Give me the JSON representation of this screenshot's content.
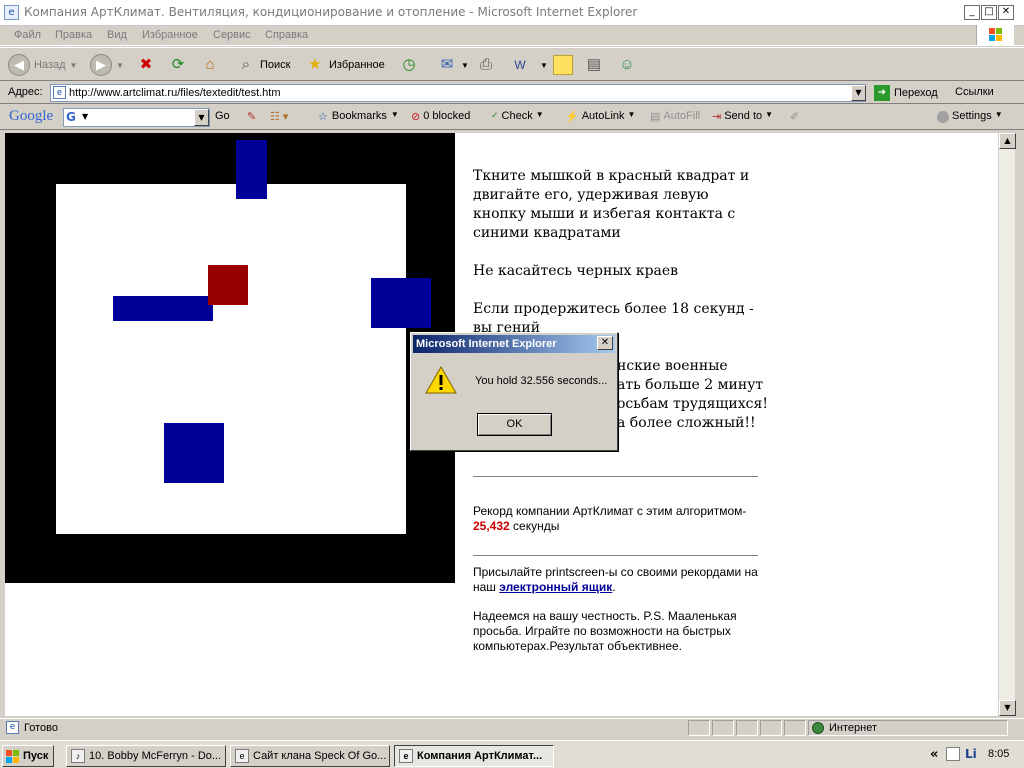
{
  "window": {
    "title": "Компания АртКлимат. Вентиляция, кондиционирование и отопление - Microsoft Internet Explorer",
    "min": "_",
    "max": "□",
    "close": "✕"
  },
  "menu": [
    "Файл",
    "Правка",
    "Вид",
    "Избранное",
    "Сервис",
    "Справка"
  ],
  "toolbar": {
    "back": "Назад",
    "search": "Поиск",
    "favorites": "Избранное"
  },
  "address": {
    "label": "Адрес:",
    "url": "http://www.artclimat.ru/files/textedit/test.htm",
    "go": "Переход",
    "links": "Ссылки"
  },
  "google_bar": {
    "logo": "Google",
    "go": "Go",
    "bookmarks": "Bookmarks",
    "blocked": "0 blocked",
    "check": "Check",
    "autolink": "AutoLink",
    "autofill": "AutoFill",
    "sendto": "Send to",
    "settings": "Settings"
  },
  "content": {
    "instr": "Ткните мышкой в красный квадрат и двигайте его, удерживая левую кнопку мыши и избегая контакта с синими квадратами",
    "no_touch": "Не касайтесь черных краев",
    "genius_pre": "Если продержитесь более 18 секунд - вы гений",
    "military_l1": "нские военные",
    "military_l2": "ать больше 2 минут",
    "military_l3": "осьбам трудящихся!",
    "military_l4": "а более сложный!!",
    "record_pre": "Рекорд компании АртКлимат с этим алгоритмом-",
    "record_value": "25,432",
    "record_unit": " секунды",
    "send_pre": "Присылайте printscreen-ы со своими рекордами на наш ",
    "send_link": "электронный ящик",
    "send_post": ".",
    "honest": "Надеемся на вашу честность. P.S. Мааленькая просьба. Играйте по возможности на быстрых компьютерах.Результат объективнее."
  },
  "dialog": {
    "title": "Microsoft Internet Explorer",
    "message": "You hold 32.556 seconds...",
    "ok": "OK",
    "close": "✕"
  },
  "status": {
    "text": "Готово",
    "zone": "Интернет"
  },
  "taskbar": {
    "start": "Пуск",
    "tasks": [
      "10. Bobby McFerryn - Do...",
      "Сайт клана Speck Of Go...",
      "Компания АртКлимат..."
    ],
    "chevron": "«",
    "time": "8:05"
  },
  "colors": {
    "red_square": "#990000",
    "blue_square": "#000099",
    "record": "#cc0000",
    "link": "#000099"
  }
}
